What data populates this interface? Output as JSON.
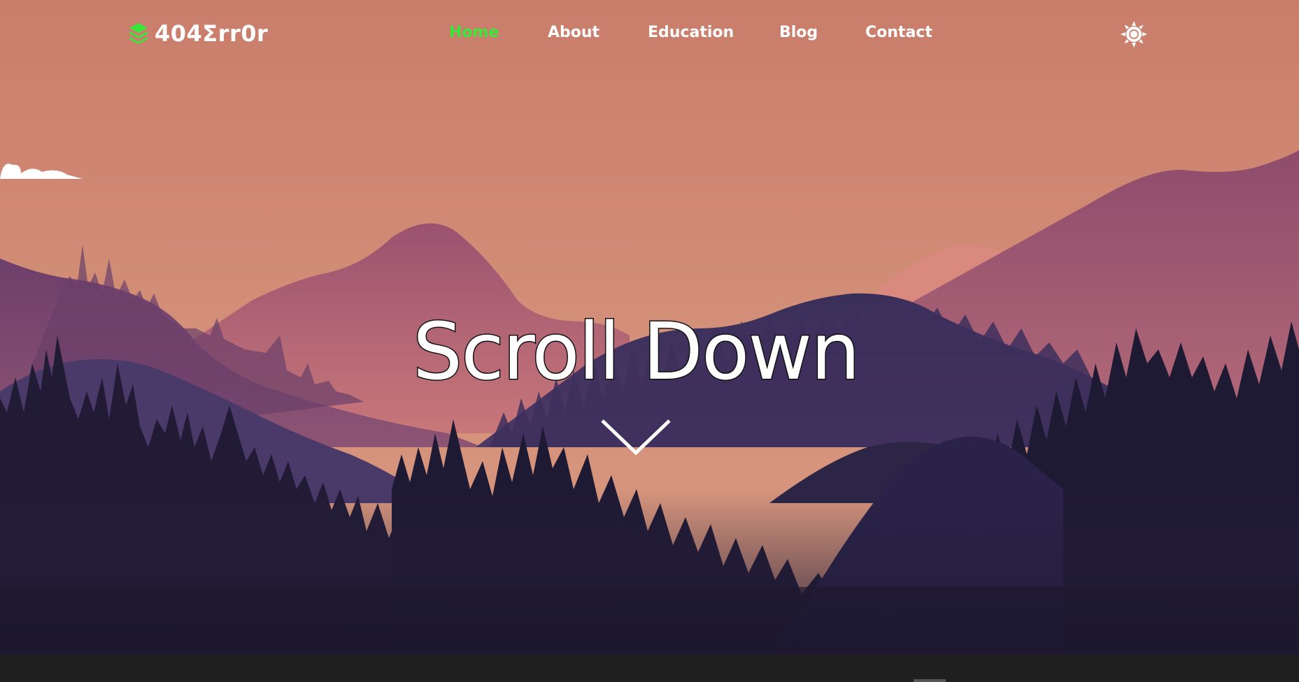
{
  "brand": {
    "logo_text": "404Σrr0r",
    "logo_icon": "layers-icon"
  },
  "nav": {
    "items": [
      {
        "label": "Home",
        "active": true
      },
      {
        "label": "About",
        "active": false
      },
      {
        "label": "Education",
        "active": false
      },
      {
        "label": "Blog",
        "active": false
      },
      {
        "label": "Contact",
        "active": false
      }
    ],
    "theme_toggle_icon": "sun-icon"
  },
  "hero": {
    "title": "Scroll Down",
    "arrow_icon": "chevron-down-icon"
  },
  "colors": {
    "accent": "#39e639",
    "sky_top": "#c97f6c",
    "sky_bottom": "#d6937a",
    "mountain_far": "#a8586f",
    "mountain_mid": "#5a3f6d",
    "forest_dark": "#1d1830",
    "footer": "#1f1f1f"
  }
}
